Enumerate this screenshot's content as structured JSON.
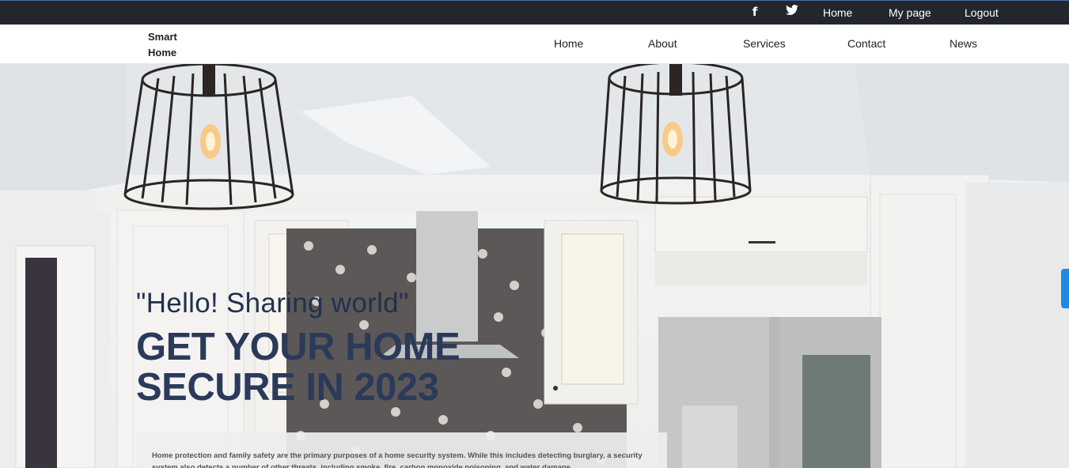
{
  "topbar": {
    "social_icons": [
      "facebook-icon",
      "twitter-icon"
    ],
    "facebook_glyph": "f",
    "twitter_glyph": "🐦",
    "links": [
      {
        "label": "Home"
      },
      {
        "label": "My page"
      },
      {
        "label": "Logout"
      }
    ]
  },
  "nav": {
    "brand": "Smart Home",
    "items": [
      {
        "label": "Home"
      },
      {
        "label": "About"
      },
      {
        "label": "Services"
      },
      {
        "label": "Contact"
      },
      {
        "label": "News"
      }
    ]
  },
  "hero": {
    "tagline": "\"Hello! Sharing world\"",
    "headline": "GET YOUR HOME SECURE IN 2023",
    "description": "Home protection and family safety are the primary purposes of a home security system. While this includes detecting burglary, a security system also detects a number of other threats, including smoke, fire, carbon monoxide poisoning, and water damage."
  },
  "colors": {
    "topbar_bg": "#23262d",
    "headline": "#2b3a5a",
    "accent_tab": "#1e88e5"
  }
}
